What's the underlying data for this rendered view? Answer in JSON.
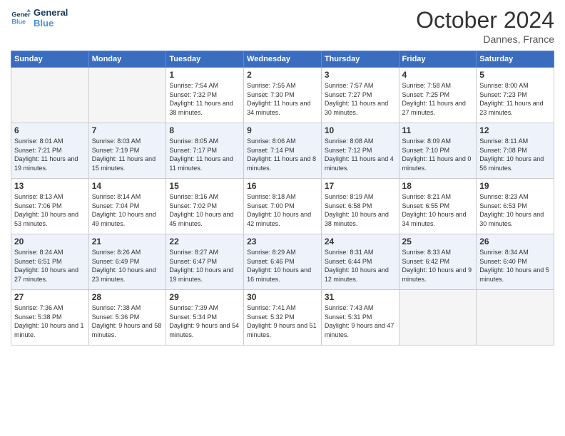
{
  "header": {
    "logo_line1": "General",
    "logo_line2": "Blue",
    "month": "October 2024",
    "location": "Dannes, France"
  },
  "days_of_week": [
    "Sunday",
    "Monday",
    "Tuesday",
    "Wednesday",
    "Thursday",
    "Friday",
    "Saturday"
  ],
  "weeks": [
    [
      {
        "day": "",
        "info": ""
      },
      {
        "day": "",
        "info": ""
      },
      {
        "day": "1",
        "info": "Sunrise: 7:54 AM\nSunset: 7:32 PM\nDaylight: 11 hours and 38 minutes."
      },
      {
        "day": "2",
        "info": "Sunrise: 7:55 AM\nSunset: 7:30 PM\nDaylight: 11 hours and 34 minutes."
      },
      {
        "day": "3",
        "info": "Sunrise: 7:57 AM\nSunset: 7:27 PM\nDaylight: 11 hours and 30 minutes."
      },
      {
        "day": "4",
        "info": "Sunrise: 7:58 AM\nSunset: 7:25 PM\nDaylight: 11 hours and 27 minutes."
      },
      {
        "day": "5",
        "info": "Sunrise: 8:00 AM\nSunset: 7:23 PM\nDaylight: 11 hours and 23 minutes."
      }
    ],
    [
      {
        "day": "6",
        "info": "Sunrise: 8:01 AM\nSunset: 7:21 PM\nDaylight: 11 hours and 19 minutes."
      },
      {
        "day": "7",
        "info": "Sunrise: 8:03 AM\nSunset: 7:19 PM\nDaylight: 11 hours and 15 minutes."
      },
      {
        "day": "8",
        "info": "Sunrise: 8:05 AM\nSunset: 7:17 PM\nDaylight: 11 hours and 11 minutes."
      },
      {
        "day": "9",
        "info": "Sunrise: 8:06 AM\nSunset: 7:14 PM\nDaylight: 11 hours and 8 minutes."
      },
      {
        "day": "10",
        "info": "Sunrise: 8:08 AM\nSunset: 7:12 PM\nDaylight: 11 hours and 4 minutes."
      },
      {
        "day": "11",
        "info": "Sunrise: 8:09 AM\nSunset: 7:10 PM\nDaylight: 11 hours and 0 minutes."
      },
      {
        "day": "12",
        "info": "Sunrise: 8:11 AM\nSunset: 7:08 PM\nDaylight: 10 hours and 56 minutes."
      }
    ],
    [
      {
        "day": "13",
        "info": "Sunrise: 8:13 AM\nSunset: 7:06 PM\nDaylight: 10 hours and 53 minutes."
      },
      {
        "day": "14",
        "info": "Sunrise: 8:14 AM\nSunset: 7:04 PM\nDaylight: 10 hours and 49 minutes."
      },
      {
        "day": "15",
        "info": "Sunrise: 8:16 AM\nSunset: 7:02 PM\nDaylight: 10 hours and 45 minutes."
      },
      {
        "day": "16",
        "info": "Sunrise: 8:18 AM\nSunset: 7:00 PM\nDaylight: 10 hours and 42 minutes."
      },
      {
        "day": "17",
        "info": "Sunrise: 8:19 AM\nSunset: 6:58 PM\nDaylight: 10 hours and 38 minutes."
      },
      {
        "day": "18",
        "info": "Sunrise: 8:21 AM\nSunset: 6:55 PM\nDaylight: 10 hours and 34 minutes."
      },
      {
        "day": "19",
        "info": "Sunrise: 8:23 AM\nSunset: 6:53 PM\nDaylight: 10 hours and 30 minutes."
      }
    ],
    [
      {
        "day": "20",
        "info": "Sunrise: 8:24 AM\nSunset: 6:51 PM\nDaylight: 10 hours and 27 minutes."
      },
      {
        "day": "21",
        "info": "Sunrise: 8:26 AM\nSunset: 6:49 PM\nDaylight: 10 hours and 23 minutes."
      },
      {
        "day": "22",
        "info": "Sunrise: 8:27 AM\nSunset: 6:47 PM\nDaylight: 10 hours and 19 minutes."
      },
      {
        "day": "23",
        "info": "Sunrise: 8:29 AM\nSunset: 6:46 PM\nDaylight: 10 hours and 16 minutes."
      },
      {
        "day": "24",
        "info": "Sunrise: 8:31 AM\nSunset: 6:44 PM\nDaylight: 10 hours and 12 minutes."
      },
      {
        "day": "25",
        "info": "Sunrise: 8:33 AM\nSunset: 6:42 PM\nDaylight: 10 hours and 9 minutes."
      },
      {
        "day": "26",
        "info": "Sunrise: 8:34 AM\nSunset: 6:40 PM\nDaylight: 10 hours and 5 minutes."
      }
    ],
    [
      {
        "day": "27",
        "info": "Sunrise: 7:36 AM\nSunset: 5:38 PM\nDaylight: 10 hours and 1 minute."
      },
      {
        "day": "28",
        "info": "Sunrise: 7:38 AM\nSunset: 5:36 PM\nDaylight: 9 hours and 58 minutes."
      },
      {
        "day": "29",
        "info": "Sunrise: 7:39 AM\nSunset: 5:34 PM\nDaylight: 9 hours and 54 minutes."
      },
      {
        "day": "30",
        "info": "Sunrise: 7:41 AM\nSunset: 5:32 PM\nDaylight: 9 hours and 51 minutes."
      },
      {
        "day": "31",
        "info": "Sunrise: 7:43 AM\nSunset: 5:31 PM\nDaylight: 9 hours and 47 minutes."
      },
      {
        "day": "",
        "info": ""
      },
      {
        "day": "",
        "info": ""
      }
    ]
  ]
}
